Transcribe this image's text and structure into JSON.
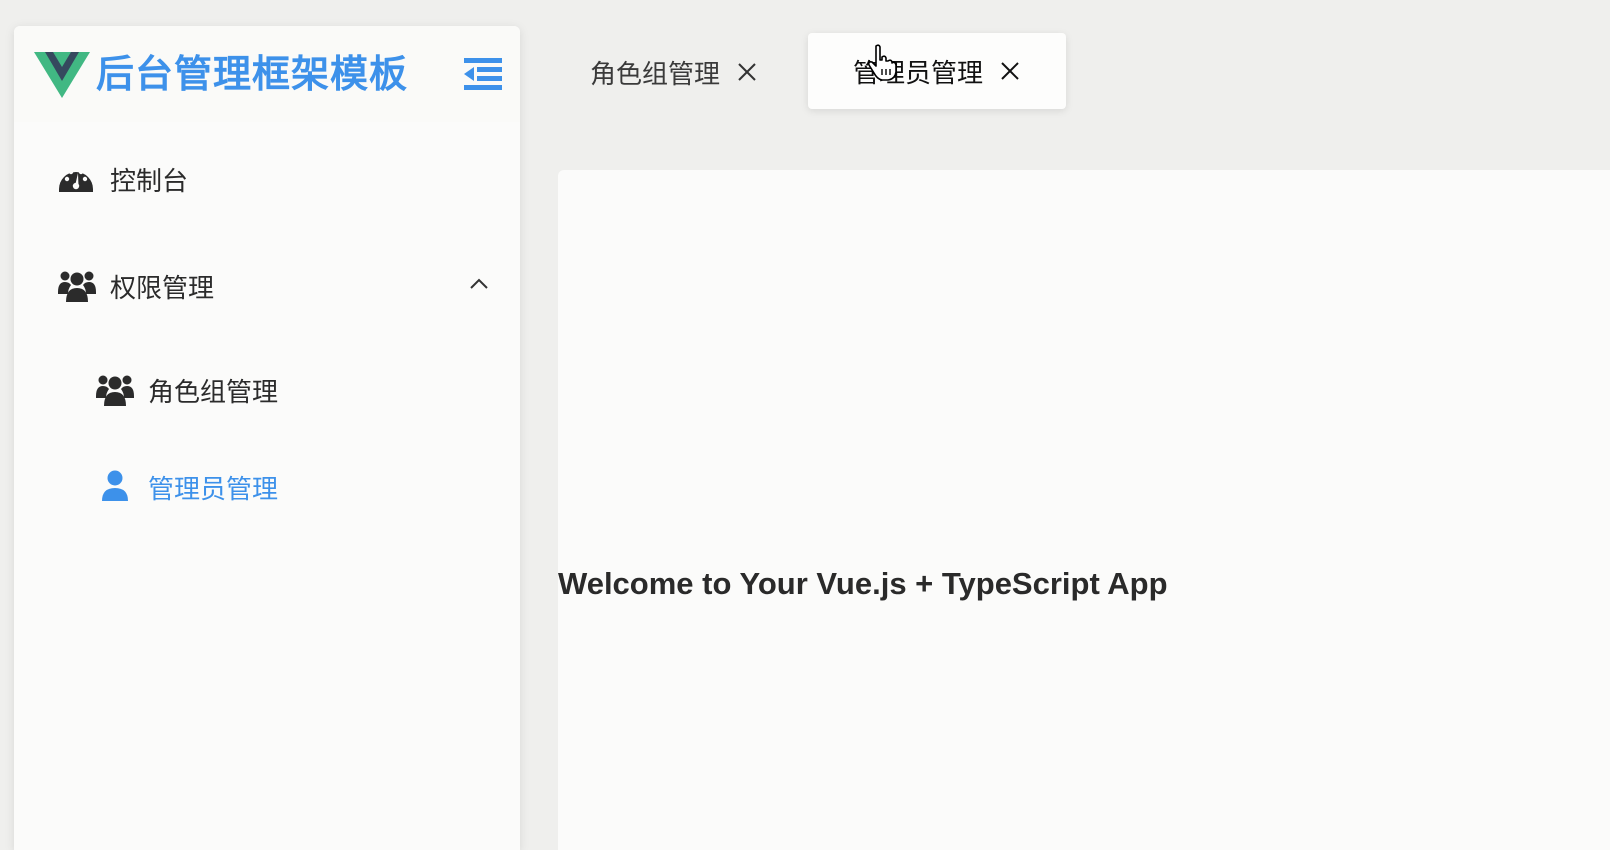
{
  "brand": {
    "title": "后台管理框架模板",
    "logo_icon": "vue-logo-icon",
    "collapse_icon": "menu-fold-icon",
    "accent_color": "#3d91ea"
  },
  "sidebar": {
    "items": [
      {
        "label": "控制台",
        "icon": "dashboard-icon"
      },
      {
        "label": "权限管理",
        "icon": "users-icon",
        "expanded": true,
        "children": [
          {
            "label": "角色组管理",
            "icon": "users-icon"
          },
          {
            "label": "管理员管理",
            "icon": "user-icon",
            "active": true
          }
        ]
      }
    ]
  },
  "tabs": [
    {
      "label": "角色组管理",
      "active": false
    },
    {
      "label": "管理员管理",
      "active": true
    }
  ],
  "main": {
    "welcome": "Welcome to Your Vue.js + TypeScript App"
  }
}
